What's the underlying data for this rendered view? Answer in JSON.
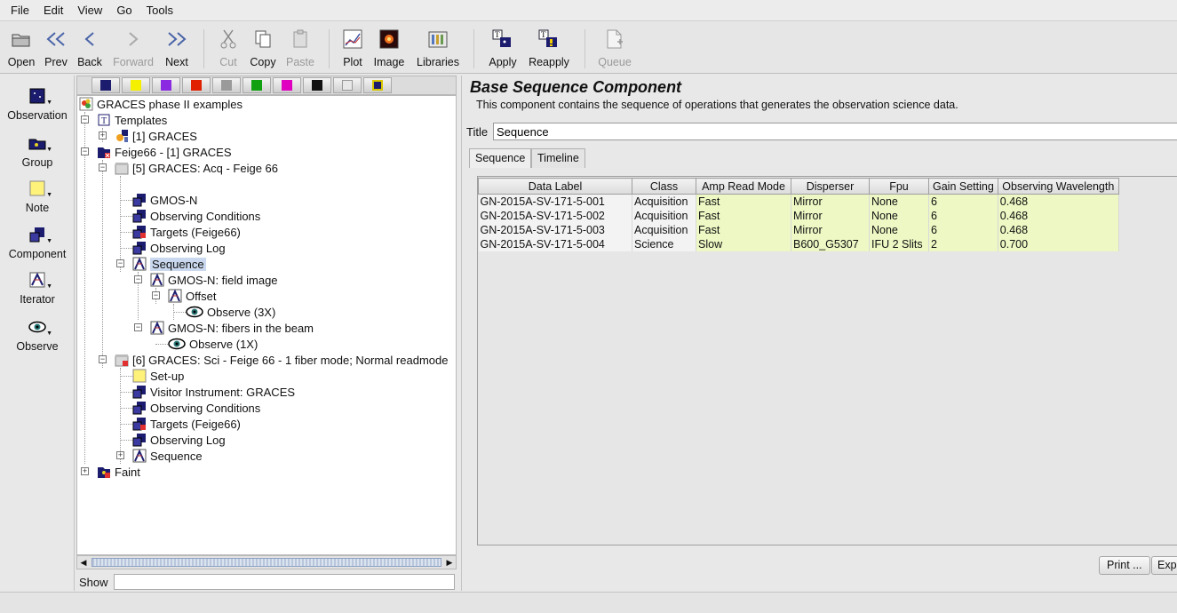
{
  "menu": [
    "File",
    "Edit",
    "View",
    "Go",
    "Tools"
  ],
  "toolbar": {
    "open": "Open",
    "prev": "Prev",
    "back": "Back",
    "forward": "Forward",
    "next": "Next",
    "cut": "Cut",
    "copy": "Copy",
    "paste": "Paste",
    "plot": "Plot",
    "image": "Image",
    "libraries": "Libraries",
    "apply": "Apply",
    "reapply": "Reapply",
    "queue": "Queue"
  },
  "palette": [
    "Observation",
    "Group",
    "Note",
    "Component",
    "Iterator",
    "Observe"
  ],
  "filter_colors": [
    "#1c1c6e",
    "#f5f000",
    "#8a2be2",
    "#e02000",
    "#9a9a9a",
    "#10a010",
    "#e000c0",
    "#111111",
    "#e0e0e0",
    "#d9c600"
  ],
  "tree": {
    "root": "GRACES phase II examples",
    "templates": "Templates",
    "templates_graces": "[1] GRACES",
    "feige": "Feige66 - [1] GRACES",
    "acq": "[5] GRACES: Acq - Feige 66",
    "gmos_n": "GMOS-N",
    "obs_cond": "Observing Conditions",
    "targets": "Targets (Feige66)",
    "obs_log": "Observing Log",
    "sequence": "Sequence",
    "field_image": "GMOS-N: field image",
    "offset": "Offset",
    "observe3": "Observe (3X)",
    "fibers": "GMOS-N: fibers in the beam",
    "observe1": "Observe (1X)",
    "sci": "[6] GRACES: Sci - Feige 66 - 1 fiber mode; Normal readmode",
    "setup": "Set-up",
    "visitor": "Visitor Instrument: GRACES",
    "obs_cond2": "Observing Conditions",
    "targets2": "Targets (Feige66)",
    "obs_log2": "Observing Log",
    "sequence2": "Sequence",
    "faint": "Faint"
  },
  "show_label": "Show",
  "component": {
    "title": "Base Sequence Component",
    "description": "This component contains the sequence of operations that generates the observation science data.",
    "title_label": "Title",
    "title_value": "Sequence",
    "tabs": [
      "Sequence",
      "Timeline"
    ]
  },
  "table": {
    "headers": [
      "Data Label",
      "Class",
      "Amp Read Mode",
      "Disperser",
      "Fpu",
      "Gain Setting",
      "Observing Wavelength"
    ],
    "rows": [
      [
        "GN-2015A-SV-171-5-001",
        "Acquisition",
        "Fast",
        "Mirror",
        "None",
        "6",
        "0.468"
      ],
      [
        "GN-2015A-SV-171-5-002",
        "Acquisition",
        "Fast",
        "Mirror",
        "None",
        "6",
        "0.468"
      ],
      [
        "GN-2015A-SV-171-5-003",
        "Acquisition",
        "Fast",
        "Mirror",
        "None",
        "6",
        "0.468"
      ],
      [
        "GN-2015A-SV-171-5-004",
        "Science",
        "Slow",
        "B600_G5307",
        "IFU 2 Slits",
        "2",
        "0.700"
      ]
    ]
  },
  "buttons": {
    "print": "Print ...",
    "export": "Exp"
  }
}
